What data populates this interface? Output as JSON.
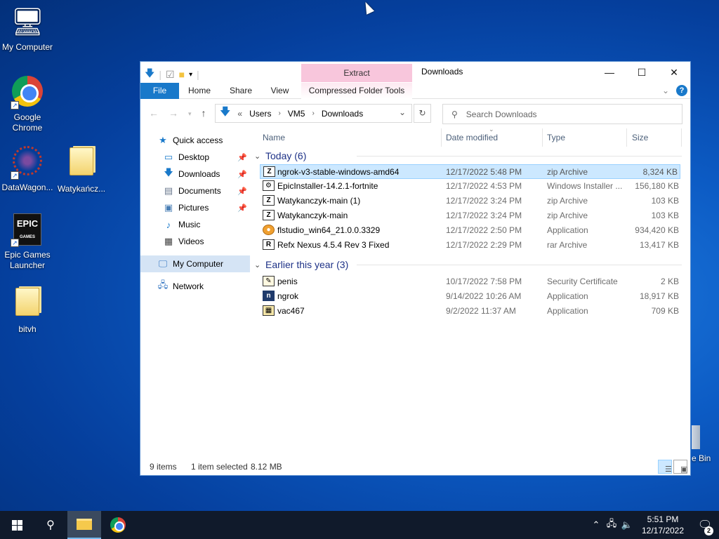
{
  "desktop": {
    "icons": [
      {
        "label": "My Computer"
      },
      {
        "label": "Google Chrome"
      },
      {
        "label": "DataWagon..."
      },
      {
        "label": "Watykańcz..."
      },
      {
        "label": "Epic Games Launcher"
      },
      {
        "label": "bitvh"
      }
    ],
    "recycle_bin_label": "e Bin"
  },
  "window": {
    "title": "Downloads",
    "contextual_tab": "Extract",
    "ribbon_tabs": [
      "File",
      "Home",
      "Share",
      "View",
      "Compressed Folder Tools"
    ],
    "controls": {
      "minimize": "—",
      "maximize": "☐",
      "close": "✕"
    },
    "help": "?"
  },
  "address": {
    "overflow": "«",
    "crumbs": [
      "Users",
      "VM5",
      "Downloads"
    ],
    "search_placeholder": "Search Downloads"
  },
  "sidebar": {
    "items": [
      {
        "label": "Quick access"
      },
      {
        "label": "Desktop"
      },
      {
        "label": "Downloads"
      },
      {
        "label": "Documents"
      },
      {
        "label": "Pictures"
      },
      {
        "label": "Music"
      },
      {
        "label": "Videos"
      },
      {
        "label": "My Computer"
      },
      {
        "label": "Network"
      }
    ]
  },
  "columns": {
    "name": "Name",
    "date": "Date modified",
    "type": "Type",
    "size": "Size"
  },
  "groups": [
    {
      "label": "Today (6)",
      "files": [
        {
          "name": "ngrok-v3-stable-windows-amd64",
          "date": "12/17/2022 5:48 PM",
          "type": "zip Archive",
          "size": "8,324 KB",
          "icon": "zip-icon"
        },
        {
          "name": "EpicInstaller-14.2.1-fortnite",
          "date": "12/17/2022 4:53 PM",
          "type": "Windows Installer ...",
          "size": "156,180 KB",
          "icon": "installer-icon"
        },
        {
          "name": "Watykanczyk-main (1)",
          "date": "12/17/2022 3:24 PM",
          "type": "zip Archive",
          "size": "103 KB",
          "icon": "zip-icon"
        },
        {
          "name": "Watykanczyk-main",
          "date": "12/17/2022 3:24 PM",
          "type": "zip Archive",
          "size": "103 KB",
          "icon": "zip-icon"
        },
        {
          "name": "flstudio_win64_21.0.0.3329",
          "date": "12/17/2022 2:50 PM",
          "type": "Application",
          "size": "934,420 KB",
          "icon": "app-icon"
        },
        {
          "name": "Refx Nexus 4.5.4 Rev 3 Fixed",
          "date": "12/17/2022 2:29 PM",
          "type": "rar Archive",
          "size": "13,417 KB",
          "icon": "rar-icon"
        }
      ]
    },
    {
      "label": "Earlier this year (3)",
      "files": [
        {
          "name": "penis",
          "date": "10/17/2022 7:58 PM",
          "type": "Security Certificate",
          "size": "2 KB",
          "icon": "certificate-icon"
        },
        {
          "name": "ngrok",
          "date": "9/14/2022 10:26 AM",
          "type": "Application",
          "size": "18,917 KB",
          "icon": "ngrok-icon"
        },
        {
          "name": "vac467",
          "date": "9/2/2022 11:37 AM",
          "type": "Application",
          "size": "709 KB",
          "icon": "app-icon"
        }
      ]
    }
  ],
  "status": {
    "items": "9 items",
    "selected": "1 item selected",
    "size": "8.12 MB"
  },
  "taskbar": {
    "time": "5:51 PM",
    "date": "12/17/2022",
    "notifications": "2"
  },
  "colors": {
    "accent": "#1979ca",
    "selection": "#cce8ff",
    "contextual": "#f8c6dc",
    "taskbar": "#101a2b"
  }
}
